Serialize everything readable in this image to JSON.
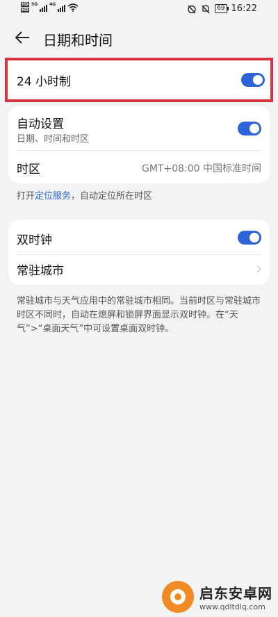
{
  "status_bar": {
    "sim1": "HD",
    "sim2": "HD",
    "net1": "5G",
    "net2": "4G",
    "battery": "69",
    "time": "16:22"
  },
  "header": {
    "back_icon": "arrow-left-icon",
    "title": "日期和时间"
  },
  "hour24": {
    "label": "24 小时制",
    "enabled": true
  },
  "auto_section": {
    "auto_title": "自动设置",
    "auto_subtitle": "日期、时间和时区",
    "auto_enabled": true,
    "timezone_label": "时区",
    "timezone_value": "GMT+08:00 中国标准时间"
  },
  "location_note": {
    "prefix": "打开",
    "link": "定位服务",
    "suffix": "，自动定位所在时区"
  },
  "dual_clock": {
    "label": "双时钟",
    "enabled": true,
    "city_label": "常驻城市"
  },
  "dual_note": "常驻城市与天气应用中的常驻城市相同。当前时区与常驻城市时区不同时，自动在熄屏和锁屏界面显示双时钟。在“天气”>“桌面天气”中可设置桌面双时钟。",
  "watermark": {
    "title": "启东安卓网",
    "url": "www.qdltdlq.com"
  },
  "colors": {
    "accent": "#2e63d8",
    "highlight": "#d9333f",
    "background": "#f1f3f5"
  }
}
